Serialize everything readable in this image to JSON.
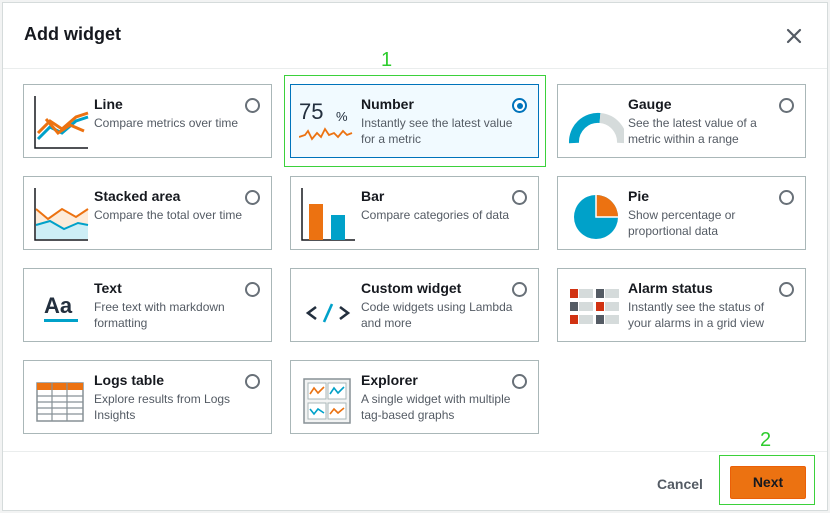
{
  "dialog": {
    "title": "Add widget",
    "cancel_label": "Cancel",
    "next_label": "Next"
  },
  "annotations": {
    "one": "1",
    "two": "2"
  },
  "widgets": [
    {
      "name": "Line",
      "description": "Compare metrics over time",
      "selected": false,
      "icon": "line-chart-icon"
    },
    {
      "name": "Number",
      "description": "Instantly see the latest value for a metric",
      "selected": true,
      "icon": "number-icon",
      "icon_text": "75",
      "icon_unit": "%"
    },
    {
      "name": "Gauge",
      "description": "See the latest value of a metric within a range",
      "selected": false,
      "icon": "gauge-icon"
    },
    {
      "name": "Stacked area",
      "description": "Compare the total over time",
      "selected": false,
      "icon": "stacked-area-icon"
    },
    {
      "name": "Bar",
      "description": "Compare categories of data",
      "selected": false,
      "icon": "bar-chart-icon"
    },
    {
      "name": "Pie",
      "description": "Show percentage or proportional data",
      "selected": false,
      "icon": "pie-chart-icon"
    },
    {
      "name": "Text",
      "description": "Free text with markdown formatting",
      "selected": false,
      "icon": "text-icon",
      "icon_text": "Aa"
    },
    {
      "name": "Custom widget",
      "description": "Code widgets using Lambda and more",
      "selected": false,
      "icon": "code-icon",
      "icon_text": "</>"
    },
    {
      "name": "Alarm status",
      "description": "Instantly see the status of your alarms in a grid view",
      "selected": false,
      "icon": "alarm-grid-icon"
    },
    {
      "name": "Logs table",
      "description": "Explore results from Logs Insights",
      "selected": false,
      "icon": "logs-table-icon"
    },
    {
      "name": "Explorer",
      "description": "A single widget with multiple tag-based graphs",
      "selected": false,
      "icon": "explorer-icon"
    }
  ],
  "colors": {
    "accent": "#0073bb",
    "orange": "#ec7211",
    "teal": "#00a1c9",
    "annotation": "#3bd13b"
  }
}
